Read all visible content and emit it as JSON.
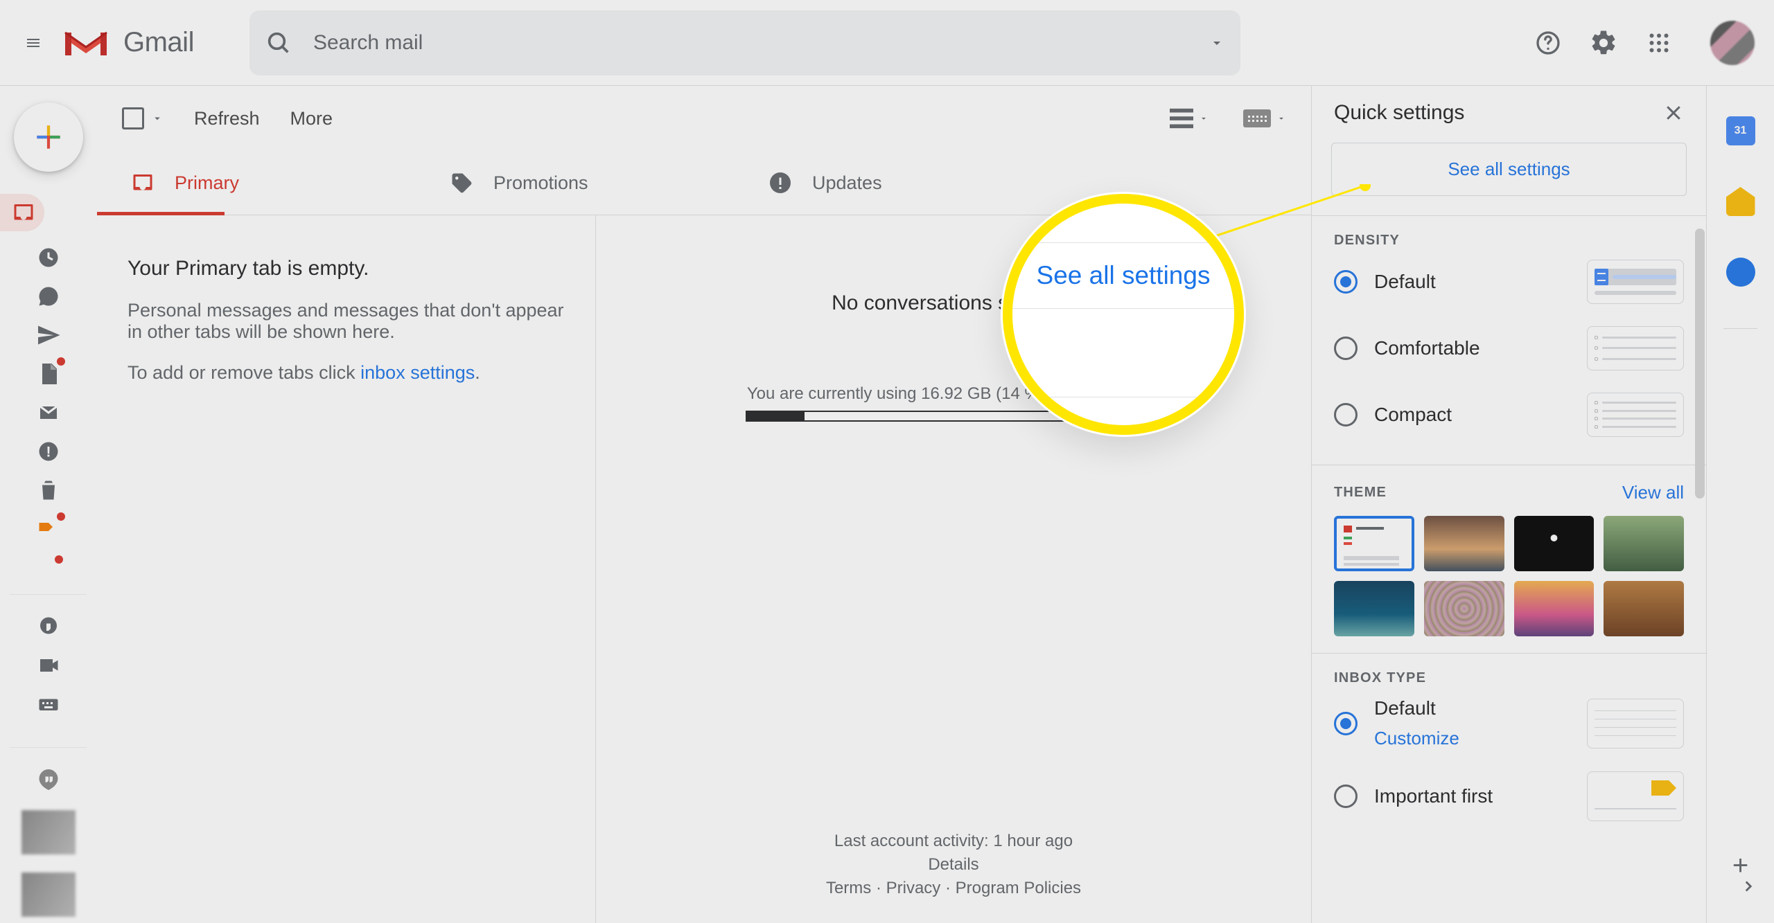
{
  "header": {
    "logo_text": "Gmail",
    "search_placeholder": "Search mail"
  },
  "toolbar": {
    "refresh": "Refresh",
    "more": "More"
  },
  "category_tabs": {
    "primary": "Primary",
    "promotions": "Promotions",
    "updates": "Updates"
  },
  "list_pane": {
    "empty_title": "Your Primary tab is empty.",
    "empty_sub": "Personal messages and messages that don't appear in other tabs will be shown here.",
    "configure_prefix": "To add or remove tabs click ",
    "configure_link": "inbox settings",
    "configure_suffix": "."
  },
  "read_pane": {
    "no_conversation": "No conversations selected",
    "storage_line": "You are currently using 16.92 GB (14 %) of your 119 GB",
    "progress_percent": 14,
    "activity": "Last account activity: 1 hour ago",
    "details": "Details",
    "terms": "Terms",
    "privacy": "Privacy",
    "policies": "Program Policies"
  },
  "quick_settings": {
    "title": "Quick settings",
    "see_all": "See all settings",
    "density_label": "DENSITY",
    "density_options": {
      "default": "Default",
      "comfortable": "Comfortable",
      "compact": "Compact"
    },
    "theme_label": "THEME",
    "view_all": "View all",
    "inbox_label": "INBOX TYPE",
    "inbox_default": "Default",
    "customize": "Customize",
    "inbox_important": "Important first"
  },
  "callout": {
    "text": "See all settings"
  },
  "addons": {
    "calendar_date": "31"
  }
}
